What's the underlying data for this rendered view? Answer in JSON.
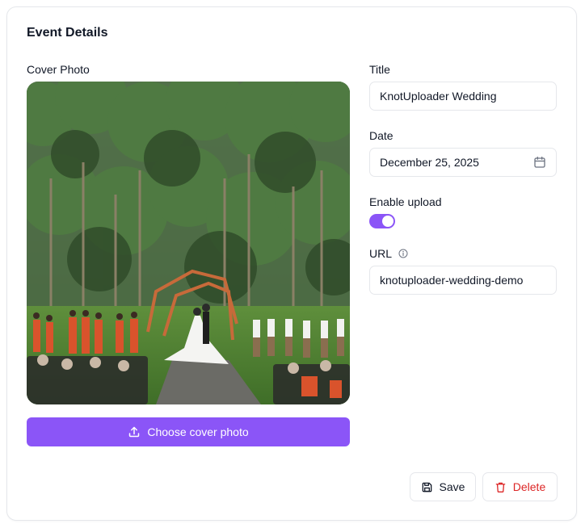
{
  "card": {
    "title": "Event Details"
  },
  "cover": {
    "label": "Cover Photo",
    "button_label": "Choose cover photo",
    "icon": "upload-icon"
  },
  "title_field": {
    "label": "Title",
    "value": "KnotUploader Wedding"
  },
  "date_field": {
    "label": "Date",
    "value": "December 25, 2025",
    "icon": "calendar-icon"
  },
  "upload_toggle": {
    "label": "Enable upload",
    "enabled": true
  },
  "url_field": {
    "label": "URL",
    "value": "knotuploader-wedding-demo",
    "icon": "info-icon"
  },
  "actions": {
    "save_label": "Save",
    "delete_label": "Delete"
  },
  "colors": {
    "accent": "#8b55f7",
    "danger": "#dc2626",
    "border": "#e5e7eb",
    "text": "#111827"
  }
}
